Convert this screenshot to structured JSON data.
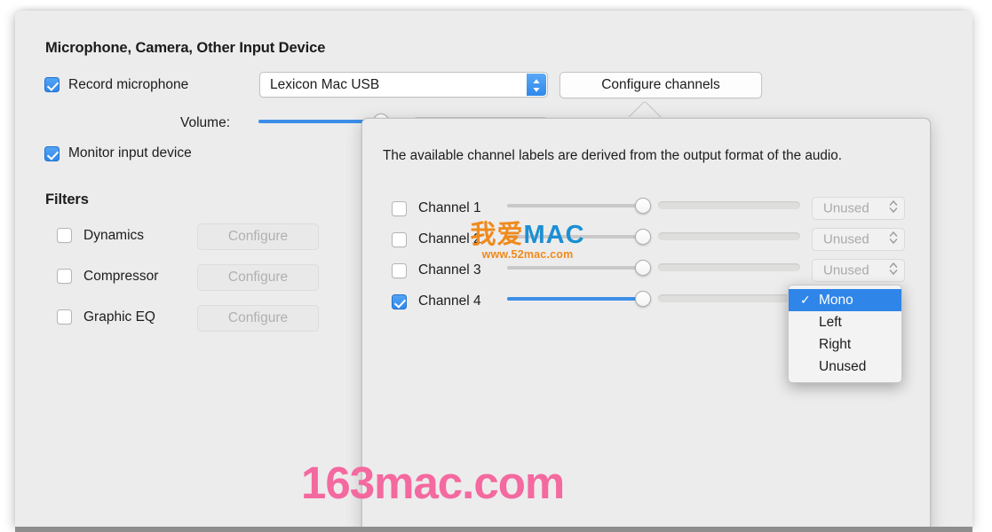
{
  "window": {
    "input_device_section": {
      "title": "Microphone, Camera, Other Input Device",
      "record_microphone": {
        "label": "Record microphone",
        "checked": true
      },
      "device_combo": {
        "value": "Lexicon Mac USB"
      },
      "configure_channels_button": {
        "label": "Configure channels"
      },
      "volume": {
        "label": "Volume:",
        "value_pct": 78
      },
      "monitor_input_device": {
        "label": "Monitor input device",
        "checked": true
      }
    },
    "filters_section": {
      "title": "Filters",
      "rows": [
        {
          "label": "Dynamics",
          "checked": false,
          "button": "Configure"
        },
        {
          "label": "Compressor",
          "checked": false,
          "button": "Configure"
        },
        {
          "label": "Graphic EQ",
          "checked": false,
          "button": "Configure"
        }
      ]
    }
  },
  "popover": {
    "description": "The available channel labels are derived from the output format of the audio.",
    "channels": [
      {
        "label": "Channel 1",
        "checked": false,
        "gain_pct": 100,
        "enabled": false,
        "assignment": "Unused"
      },
      {
        "label": "Channel 2",
        "checked": false,
        "gain_pct": 100,
        "enabled": false,
        "assignment": "Unused"
      },
      {
        "label": "Channel 3",
        "checked": false,
        "gain_pct": 100,
        "enabled": false,
        "assignment": "Unused"
      },
      {
        "label": "Channel 4",
        "checked": true,
        "gain_pct": 100,
        "enabled": true,
        "assignment": "Mono"
      }
    ]
  },
  "dropdown_menu": {
    "open_for_channel": "Channel 4",
    "selected": "Mono",
    "items": [
      {
        "label": "Mono",
        "checked": true
      },
      {
        "label": "Left",
        "checked": false
      },
      {
        "label": "Right",
        "checked": false
      },
      {
        "label": "Unused",
        "checked": false
      }
    ]
  },
  "watermarks": {
    "cn_first": "我爱",
    "cn_second": "MAC",
    "cn_url": "www.52mac.com",
    "bottom": "163mac.com"
  },
  "colors": {
    "accent_blue": "#2f85e8",
    "window_bg": "#ececec",
    "watermark_pink": "#f4699f",
    "watermark_orange": "#f08a1c",
    "watermark_blue": "#1b8fd4"
  }
}
